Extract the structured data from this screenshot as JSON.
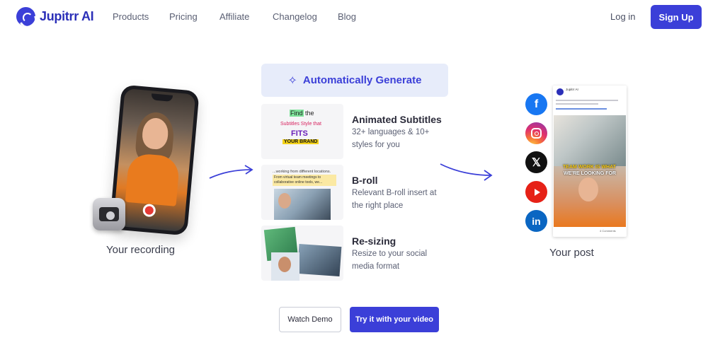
{
  "brand": {
    "name": "Jupitrr AI",
    "accent": "#3b3fd8"
  },
  "nav": {
    "links": [
      "Products",
      "Pricing",
      "Affiliate",
      "Changelog",
      "Blog"
    ],
    "login": "Log in",
    "signup": "Sign Up"
  },
  "left": {
    "caption": "Your recording"
  },
  "center": {
    "generate_label": "Automatically Generate",
    "features": [
      {
        "title": "Animated Subtitles",
        "description": "32+ languages & 10+ styles for you",
        "thumb_lines": [
          "Find",
          "the",
          "Subtitles Style that",
          "FITS",
          "YOUR BRAND"
        ]
      },
      {
        "title": "B-roll",
        "description": "Relevant B-roll insert at the right place",
        "thumb_lines": [
          "...working from different locations.",
          "From virtual team meetings to collaborative online tools, we..."
        ]
      },
      {
        "title": "Re-sizing",
        "description": "Resize to your social media format"
      }
    ]
  },
  "right": {
    "socials": [
      "facebook-icon",
      "instagram-icon",
      "x-icon",
      "youtube-icon",
      "linkedin-icon"
    ],
    "post": {
      "author": "Jupitrr AI",
      "caption_line1": "TEAM WORK IS WHAT",
      "caption_line2": "WE'RE LOOKING FOR",
      "comments": "4 Comments"
    },
    "caption": "Your post"
  },
  "cta": {
    "watch_demo": "Watch Demo",
    "try": "Try it with your video"
  }
}
